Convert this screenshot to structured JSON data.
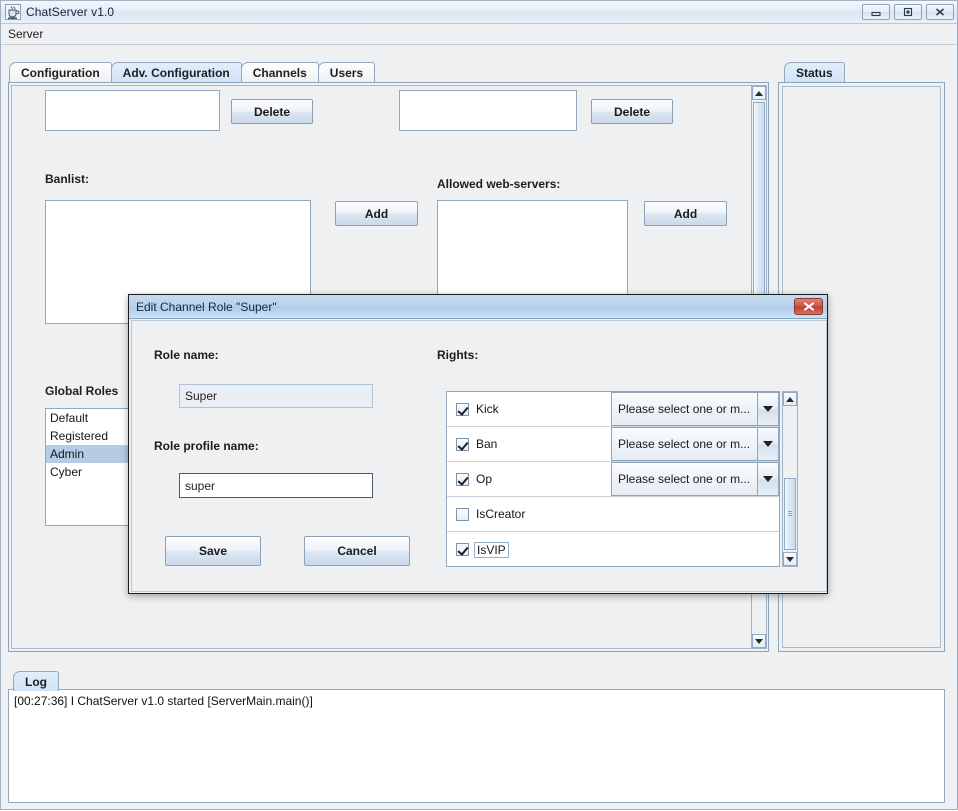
{
  "window": {
    "title": "ChatServer v1.0",
    "icon": "java-coffee-cup-icon",
    "controls": {
      "minimize": "minimize-icon",
      "maximize": "maximize-icon",
      "close": "close-icon"
    }
  },
  "menubar": {
    "items": [
      {
        "label": "Server"
      }
    ]
  },
  "main_tabs": [
    {
      "label": "Configuration",
      "selected": false
    },
    {
      "label": "Adv. Configuration",
      "selected": true
    },
    {
      "label": "Channels",
      "selected": false
    },
    {
      "label": "Users",
      "selected": false
    }
  ],
  "status_tab": {
    "label": "Status",
    "selected": true,
    "content": ""
  },
  "log_tab": {
    "label": "Log",
    "selected": true
  },
  "log": {
    "lines": [
      "[00:27:36] I ChatServer v1.0 started [ServerMain.main()]"
    ]
  },
  "adv_config": {
    "delete_button_left": "Delete",
    "delete_button_right": "Delete",
    "banlist_label": "Banlist:",
    "allowed_webservers_label": "Allowed web-servers:",
    "add_button_left": "Add",
    "add_button_right": "Add",
    "global_roles_label": "Global Roles",
    "global_roles": [
      {
        "label": "Default",
        "selected": false
      },
      {
        "label": "Registered",
        "selected": false
      },
      {
        "label": "Admin",
        "selected": true
      },
      {
        "label": "Cyber",
        "selected": false
      }
    ],
    "field_top_left_value": "",
    "field_top_right_value": "",
    "banlist_value": "",
    "allowed_webservers_value": ""
  },
  "dialog": {
    "title": "Edit Channel Role \"Super\"",
    "close_icon": "close-icon",
    "role_name_label": "Role name:",
    "role_name_value": "Super",
    "role_profile_label": "Role profile name:",
    "role_profile_value": "super",
    "save_label": "Save",
    "cancel_label": "Cancel",
    "rights_label": "Rights:",
    "rights": [
      {
        "label": "Kick",
        "checked": true,
        "has_combo": true,
        "combo_value": "Please select one or m...",
        "focused": false
      },
      {
        "label": "Ban",
        "checked": true,
        "has_combo": true,
        "combo_value": "Please select one or m...",
        "focused": false
      },
      {
        "label": "Op",
        "checked": true,
        "has_combo": true,
        "combo_value": "Please select one or m...",
        "focused": false
      },
      {
        "label": "IsCreator",
        "checked": false,
        "has_combo": false,
        "combo_value": "",
        "focused": false
      },
      {
        "label": "IsVIP",
        "checked": true,
        "has_combo": false,
        "combo_value": "",
        "focused": true
      }
    ]
  },
  "colors": {
    "window_bg": "#eef0f1",
    "tab_selected": "#cfe3f8",
    "selection": "#b6cce4",
    "dialog_title": "#b7d2ea",
    "close_button": "#c85748"
  }
}
